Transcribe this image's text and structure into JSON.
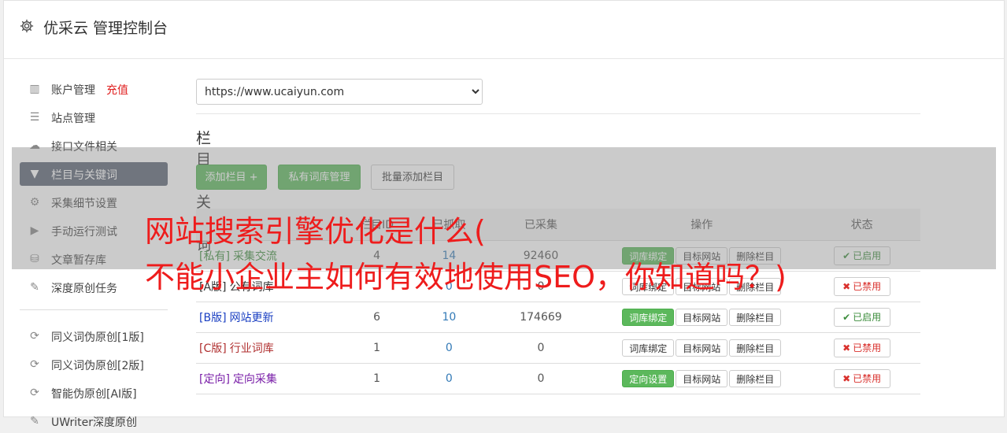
{
  "header": {
    "title": "优采云 管理控制台",
    "icon": "gear-icon"
  },
  "sidebar": {
    "items": [
      {
        "label": "账户管理",
        "extra": "充值",
        "icon": "bar-chart-icon"
      },
      {
        "label": "站点管理",
        "icon": "server-icon"
      },
      {
        "label": "接口文件相关",
        "icon": "cloud-upload-icon"
      },
      {
        "label": "栏目与关键词",
        "icon": "filter-icon",
        "active": true
      },
      {
        "label": "采集细节设置",
        "icon": "cogs-icon"
      },
      {
        "label": "手动运行测试",
        "icon": "play-circle-icon"
      },
      {
        "label": "文章暂存库",
        "icon": "database-icon"
      },
      {
        "label": "深度原创任务",
        "icon": "edit-icon"
      },
      {
        "label": "同义词伪原创[1版]",
        "icon": "refresh-icon"
      },
      {
        "label": "同义词伪原创[2版]",
        "icon": "refresh-icon"
      },
      {
        "label": "智能伪原创[AI版]",
        "icon": "refresh-icon"
      },
      {
        "label": "UWriter深度原创",
        "icon": "edit-icon"
      }
    ]
  },
  "site_select": {
    "value": "https://www.ucaiyun.com"
  },
  "section": {
    "title": "栏目与关键词"
  },
  "actions": {
    "add_column": "添加栏目 +",
    "private_lib": "私有词库管理",
    "batch_add": "批量添加栏目"
  },
  "table": {
    "headers": {
      "col1": "栏目ID",
      "col2": "已抓取",
      "col3": "已采集",
      "ops": "操作",
      "status": "状态"
    },
    "rows": [
      {
        "tag": "[私有]",
        "name": "采集交流",
        "c1": "4",
        "c2": "14",
        "c3": "92460",
        "op1": "词库绑定",
        "op1_green": true,
        "op2": "目标网站",
        "op3": "删除栏目",
        "status": "已启用",
        "on": true,
        "color": "#3c8d3c"
      },
      {
        "tag": "[A版]",
        "name": "公有词库",
        "c1": "",
        "c2": "0",
        "c3": "0",
        "op1": "词库绑定",
        "op1_green": false,
        "op2": "目标网站",
        "op3": "删除栏目",
        "status": "已禁用",
        "on": false,
        "color": "#333333"
      },
      {
        "tag": "[B版]",
        "name": "网站更新",
        "c1": "6",
        "c2": "10",
        "c3": "174669",
        "op1": "词库绑定",
        "op1_green": true,
        "op2": "目标网站",
        "op3": "删除栏目",
        "status": "已启用",
        "on": true,
        "color": "#1a3fc2"
      },
      {
        "tag": "[C版]",
        "name": "行业词库",
        "c1": "1",
        "c2": "0",
        "c3": "0",
        "op1": "词库绑定",
        "op1_green": false,
        "op2": "目标网站",
        "op3": "删除栏目",
        "status": "已禁用",
        "on": false,
        "color": "#b03030"
      },
      {
        "tag": "[定向]",
        "name": "定向采集",
        "c1": "1",
        "c2": "0",
        "c3": "0",
        "op1": "定向设置",
        "op1_green": true,
        "op2": "目标网站",
        "op3": "删除栏目",
        "status": "已禁用",
        "on": false,
        "color": "#7a1fa8"
      }
    ]
  },
  "overlay": {
    "line1": "网站搜索引擎优化是什么(",
    "line2": "不能小企业主如何有效地使用SEO，你知道吗？)"
  }
}
